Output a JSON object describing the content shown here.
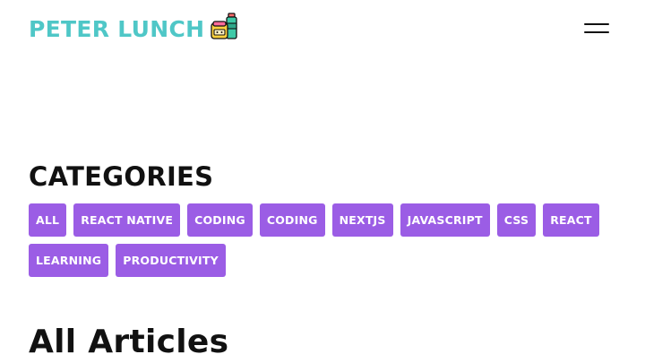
{
  "header": {
    "logo_text": "PETER LUNCH",
    "logo_icon": "lunchbox-icon",
    "menu_icon": "hamburger-icon",
    "brand_color": "#4fc7c7"
  },
  "categories": {
    "title": "CATEGORIES",
    "chip_color": "#9b5de5",
    "items": [
      "ALL",
      "REACT NATIVE",
      "CODING",
      "CODING",
      "NEXTJS",
      "JAVASCRIPT",
      "CSS",
      "REACT",
      "LEARNING",
      "PRODUCTIVITY"
    ]
  },
  "articles": {
    "title": "All Articles"
  }
}
